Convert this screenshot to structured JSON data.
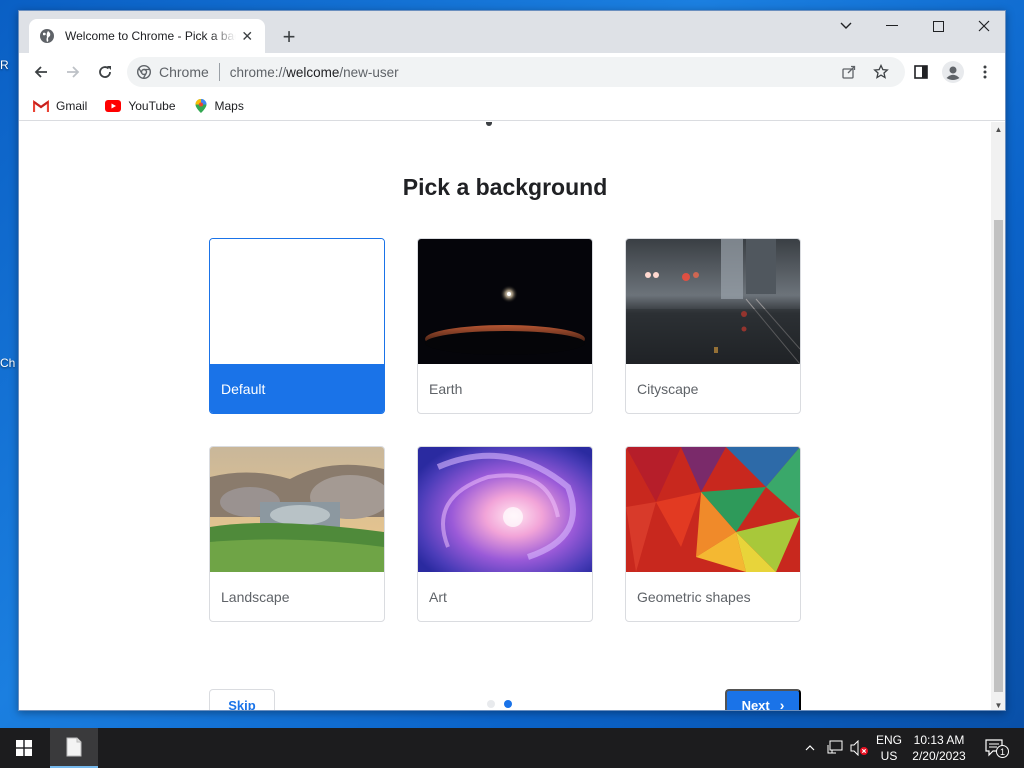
{
  "desktop": {
    "frag_1": "R",
    "frag_2": "Ch"
  },
  "browser": {
    "tab_title": "Welcome to Chrome - Pick a background",
    "tab_close": "✕",
    "new_tab": "+",
    "omnibox_site": "Chrome",
    "omnibox_url_scheme": "chrome://",
    "omnibox_url_host": "welcome",
    "omnibox_url_path": "/new-user"
  },
  "bookmarks": [
    {
      "label": "Gmail"
    },
    {
      "label": "YouTube"
    },
    {
      "label": "Maps"
    }
  ],
  "page": {
    "title": "Pick a background",
    "cards": [
      {
        "label": "Default",
        "selected": true
      },
      {
        "label": "Earth",
        "selected": false
      },
      {
        "label": "Cityscape",
        "selected": false
      },
      {
        "label": "Landscape",
        "selected": false
      },
      {
        "label": "Art",
        "selected": false
      },
      {
        "label": "Geometric shapes",
        "selected": false
      }
    ],
    "skip_label": "Skip",
    "next_label": "Next",
    "next_chevron": "›",
    "progress": {
      "total_steps": 2,
      "current_step": 2
    }
  },
  "taskbar": {
    "lang_1": "ENG",
    "lang_2": "US",
    "time": "10:13 AM",
    "date": "2/20/2023",
    "notifications": "1"
  },
  "colors": {
    "accent": "#1a73e8",
    "dot_inactive": "#e8eaed"
  }
}
